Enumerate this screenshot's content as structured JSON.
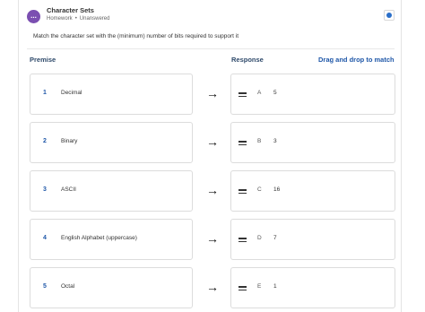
{
  "header": {
    "icon_label": "...",
    "title": "Character Sets",
    "assignment_type": "Homework",
    "status": "Unanswered"
  },
  "instructions": "Match the character set with the (minimum) number of bits required to support it",
  "columns": {
    "premise": "Premise",
    "response": "Response",
    "drag_hint": "Drag and drop to match"
  },
  "rows": [
    {
      "number": "1",
      "premise": "Decimal",
      "letter": "A",
      "value": "5"
    },
    {
      "number": "2",
      "premise": "Binary",
      "letter": "B",
      "value": "3"
    },
    {
      "number": "3",
      "premise": "ASCII",
      "letter": "C",
      "value": "16"
    },
    {
      "number": "4",
      "premise": "English Alphabet (uppercase)",
      "letter": "D",
      "value": "7"
    },
    {
      "number": "5",
      "premise": "Octal",
      "letter": "E",
      "value": "1"
    }
  ],
  "arrow_glyph": "→",
  "colors": {
    "accent": "#1f57a8",
    "question_icon": "#7b4fb1"
  }
}
